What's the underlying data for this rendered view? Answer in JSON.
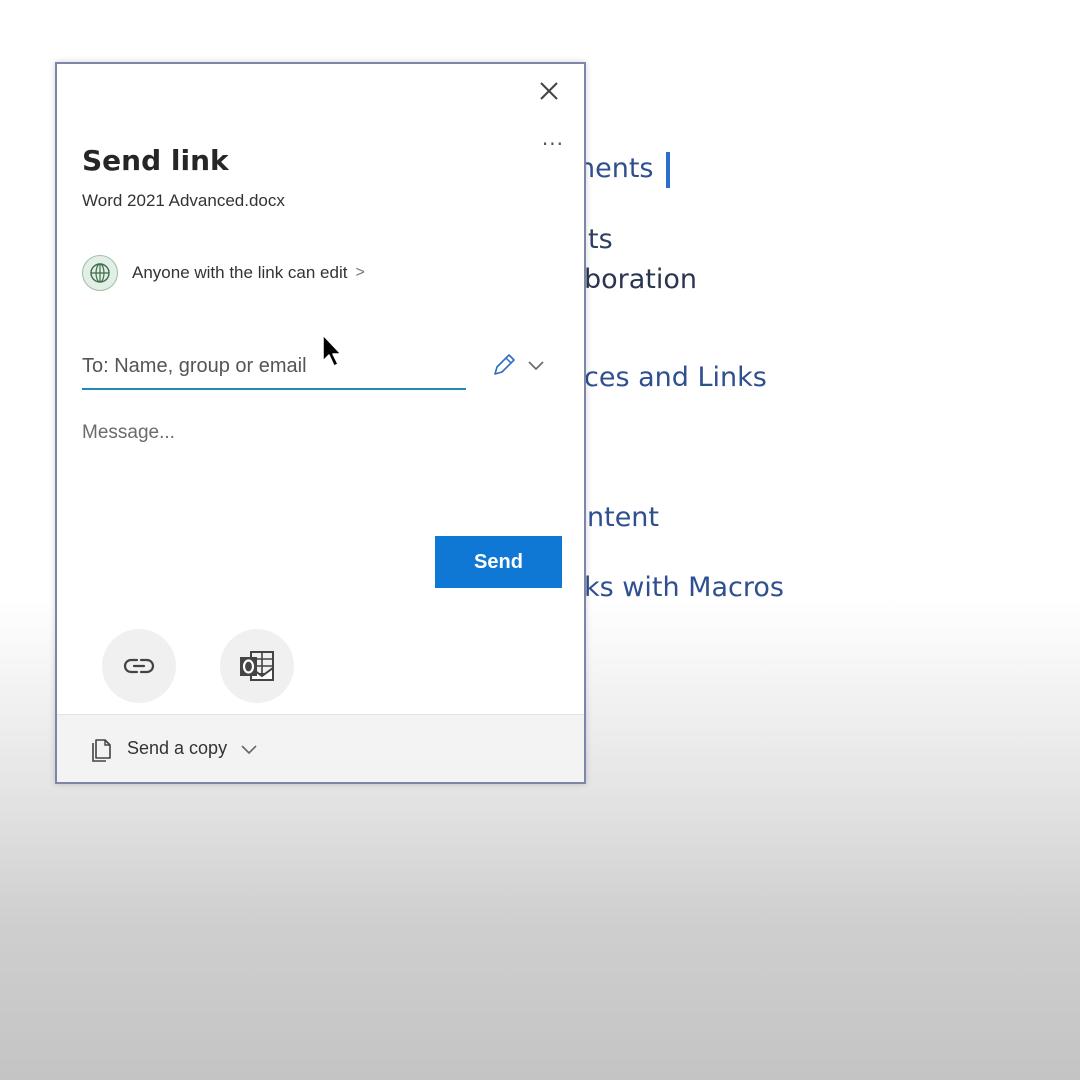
{
  "background_document": {
    "lines": [
      "nents",
      "ts",
      "boration",
      "ces and Links",
      "ntent",
      "ks with Macros"
    ]
  },
  "dialog": {
    "title": "Send link",
    "filename": "Word 2021 Advanced.docx",
    "close_icon": "close-icon",
    "more_icon": "more-options-icon",
    "more_label": "···",
    "permission": {
      "icon": "globe-icon",
      "label": "Anyone with the link can edit",
      "chevron": ">"
    },
    "to_field": {
      "placeholder": "To: Name, group or email",
      "value": ""
    },
    "edit_permission_icon": "pencil-icon",
    "message_field": {
      "placeholder": "Message...",
      "value": ""
    },
    "send_label": "Send",
    "share_options": [
      {
        "name": "copy-link",
        "icon": "link-icon"
      },
      {
        "name": "outlook",
        "icon": "outlook-icon"
      }
    ],
    "footer": {
      "send_copy_label": "Send a copy",
      "icon": "copy-document-icon"
    }
  },
  "colors": {
    "accent": "#0f78d4",
    "field_underline": "#1e8bb3",
    "doc_text": "#2f4f8f"
  }
}
